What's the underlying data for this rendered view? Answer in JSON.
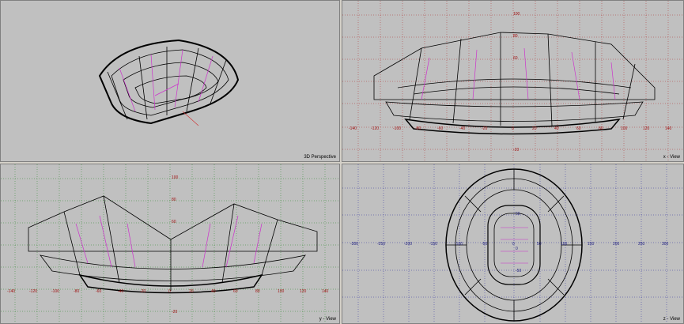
{
  "viewports": {
    "perspective": {
      "label": "3D Perspective"
    },
    "x_view": {
      "label": "x - View",
      "ticks_h": [
        "-140",
        "-120",
        "-100",
        "-80",
        "-60",
        "-40",
        "-20",
        "0",
        "20",
        "40",
        "60",
        "80",
        "100",
        "120",
        "140"
      ],
      "ticks_v": [
        "100",
        "80",
        "60",
        "-20"
      ]
    },
    "y_view": {
      "label": "y - View",
      "ticks_h": [
        "-140",
        "-120",
        "-100",
        "-80",
        "-60",
        "-40",
        "-20",
        "0",
        "20",
        "40",
        "60",
        "80",
        "100",
        "120",
        "140"
      ],
      "ticks_v": [
        "100",
        "80",
        "60",
        "-20"
      ]
    },
    "z_view": {
      "label": "z - View",
      "ticks_h": [
        "-300",
        "-250",
        "-200",
        "-150",
        "-100",
        "-50",
        "0",
        "50",
        "100",
        "150",
        "200",
        "250",
        "300"
      ],
      "ticks_v": [
        "50",
        "0",
        "-50"
      ]
    }
  },
  "colors": {
    "model": "#000000",
    "accent": "#cc33cc",
    "grid_red": "#b03030",
    "grid_green": "#2a8a2a",
    "grid_blue": "#3030a0"
  }
}
